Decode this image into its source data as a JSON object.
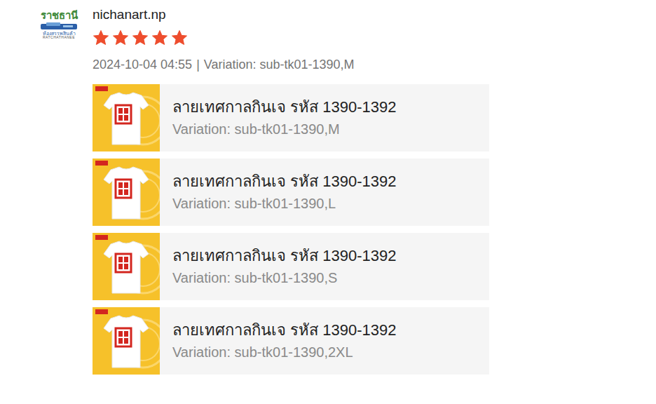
{
  "review": {
    "logo": {
      "title": "ราชธานี",
      "subtitle": "ห้องสรรพสินค้า",
      "caption": "RATCHATHANEE"
    },
    "username": "nichanart.np",
    "stars": 5,
    "date": "2024-10-04 04:55",
    "separator": "|",
    "variation": "Variation: sub-tk01-1390,M"
  },
  "products": [
    {
      "title": "ลายเทศกาลกินเจ รหัส 1390-1392",
      "variation": "Variation: sub-tk01-1390,M"
    },
    {
      "title": "ลายเทศกาลกินเจ รหัส 1390-1392",
      "variation": "Variation: sub-tk01-1390,L"
    },
    {
      "title": "ลายเทศกาลกินเจ รหัส 1390-1392",
      "variation": "Variation: sub-tk01-1390,S"
    },
    {
      "title": "ลายเทศกาลกินเจ รหัส 1390-1392",
      "variation": "Variation: sub-tk01-1390,2XL"
    }
  ]
}
